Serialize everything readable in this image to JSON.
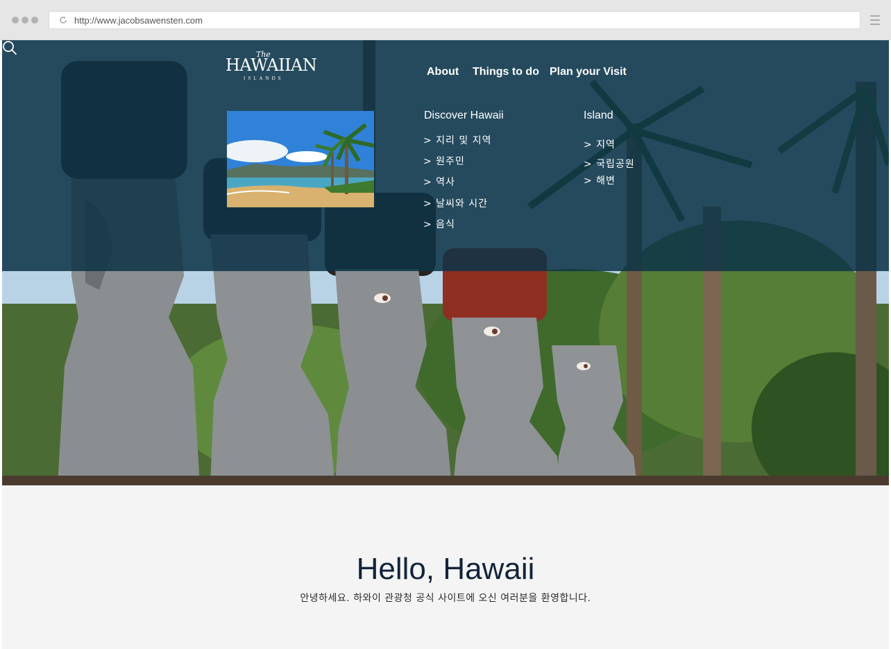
{
  "browser": {
    "url": "http://www.jacobsawensten.com"
  },
  "logo": {
    "the": "The",
    "main": "HAWAIIAN",
    "sub": "ISLANDS"
  },
  "nav": {
    "items": [
      {
        "label": "About"
      },
      {
        "label": "Things to do"
      },
      {
        "label": "Plan your Visit"
      }
    ],
    "search_icon": "search-icon"
  },
  "dropdown": {
    "columns": [
      {
        "title": "Discover Hawaii",
        "links": [
          "> 지리 및 지역",
          "> 원주민",
          "> 역사",
          "> 날씨와 시간",
          "> 음식"
        ]
      },
      {
        "title": "Island",
        "links": [
          "> 지역",
          "> 국립공원",
          "> 해변"
        ]
      }
    ]
  },
  "welcome": {
    "title": "Hello, Hawaii",
    "subtitle": "안녕하세요. 하와이 관광청 공식 사이트에 오신 여러분을 환영합니다."
  },
  "colors": {
    "overlay": "#0d3347",
    "welcome_bg": "#f4f4f4",
    "heading": "#12243a"
  }
}
